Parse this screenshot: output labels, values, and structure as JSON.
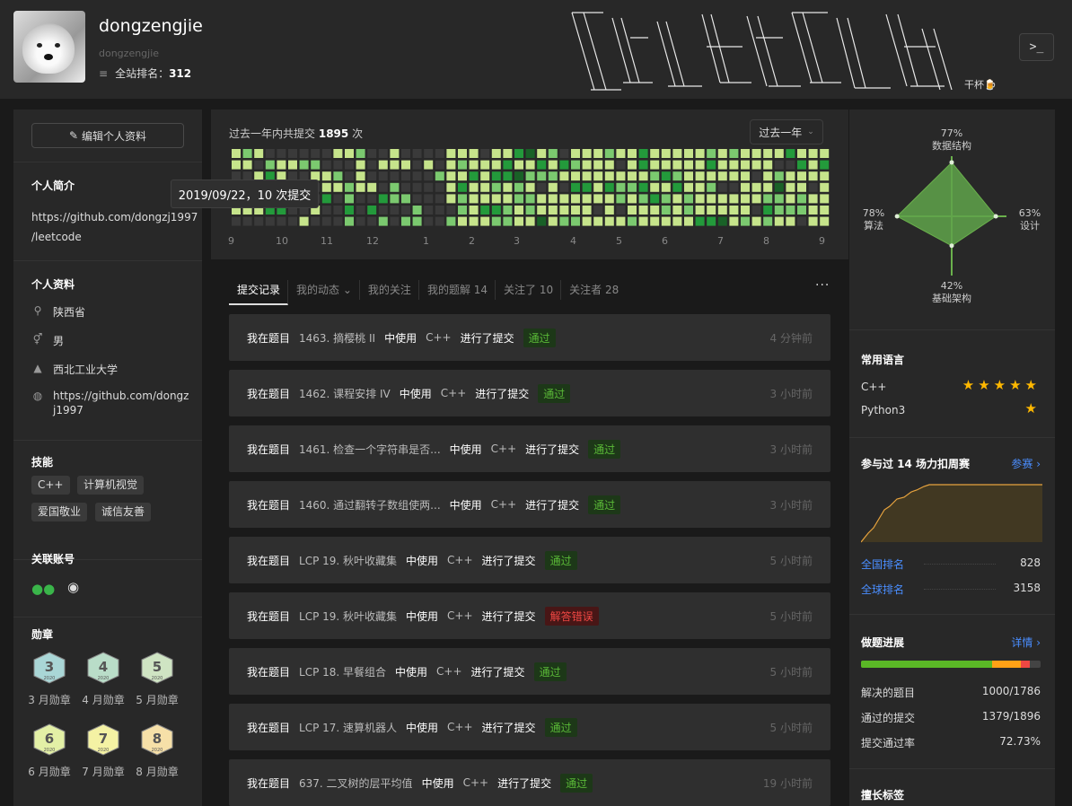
{
  "profile": {
    "name": "dongzengjie",
    "username": "dongzengjie",
    "rank_label": "全站排名：",
    "rank_value": "312",
    "cheers": "干杯🍺",
    "terminal": ">_"
  },
  "edit_button": "编辑个人资料",
  "bio": {
    "title": "个人简介",
    "lines": [
      "https://github.com/dongzj1997",
      "/leetcode"
    ]
  },
  "personal": {
    "title": "个人资料",
    "location": "陕西省",
    "gender": "男",
    "school": "西北工业大学",
    "website_lines": [
      "https://github.com/dongz",
      "j1997"
    ]
  },
  "skills": {
    "title": "技能",
    "tags": [
      "C++",
      "计算机视觉",
      "爱国敬业",
      "诚信友善"
    ]
  },
  "accounts": {
    "title": "关联账号"
  },
  "badges": {
    "title": "勋章",
    "items": [
      {
        "num": "3",
        "year": "2020",
        "label": "3 月勋章",
        "color": "#a9d6d6"
      },
      {
        "num": "4",
        "year": "2020",
        "label": "4 月勋章",
        "color": "#b9ddc8"
      },
      {
        "num": "5",
        "year": "2020",
        "label": "5 月勋章",
        "color": "#cfe4c3"
      },
      {
        "num": "6",
        "year": "2020",
        "label": "6 月勋章",
        "color": "#e3f0a6"
      },
      {
        "num": "7",
        "year": "2020",
        "label": "7 月勋章",
        "color": "#f4f2a4"
      },
      {
        "num": "8",
        "year": "2020",
        "label": "8 月勋章",
        "color": "#f6e0a8"
      }
    ]
  },
  "calendar": {
    "title_prefix": "过去一年内共提交",
    "count": "1895",
    "title_suffix": "次",
    "year_select": "过去一年",
    "months": [
      "9",
      "10",
      "11",
      "12",
      "1",
      "2",
      "3",
      "4",
      "5",
      "6",
      "7",
      "8",
      "9"
    ],
    "tooltip": "2019/09/22，10 次提交",
    "colors": {
      "none": "#3a3a3a",
      "l1": "#c6e48b",
      "l2": "#7bc96f",
      "l3": "#239a3b",
      "l4": "#196127"
    }
  },
  "tabs": [
    "提交记录",
    "我的动态",
    "我的关注",
    "我的题解 14",
    "关注了 10",
    "关注者 28"
  ],
  "submissions": [
    {
      "a": "我在题目",
      "problem": "1463. 摘樱桃 II",
      "use": "中使用",
      "lang": "C++",
      "submit": "进行了提交",
      "status": "通过",
      "ok": true,
      "time": "4 分钟前"
    },
    {
      "a": "我在题目",
      "problem": "1462. 课程安排 IV",
      "use": "中使用",
      "lang": "C++",
      "submit": "进行了提交",
      "status": "通过",
      "ok": true,
      "time": "3 小时前"
    },
    {
      "a": "我在题目",
      "problem": "1461. 检查一个字符串是否...",
      "use": "中使用",
      "lang": "C++",
      "submit": "进行了提交",
      "status": "通过",
      "ok": true,
      "time": "3 小时前"
    },
    {
      "a": "我在题目",
      "problem": "1460. 通过翻转子数组使两...",
      "use": "中使用",
      "lang": "C++",
      "submit": "进行了提交",
      "status": "通过",
      "ok": true,
      "time": "3 小时前"
    },
    {
      "a": "我在题目",
      "problem": "LCP 19. 秋叶收藏集",
      "use": "中使用",
      "lang": "C++",
      "submit": "进行了提交",
      "status": "通过",
      "ok": true,
      "time": "5 小时前"
    },
    {
      "a": "我在题目",
      "problem": "LCP 19. 秋叶收藏集",
      "use": "中使用",
      "lang": "C++",
      "submit": "进行了提交",
      "status": "解答错误",
      "ok": false,
      "time": "5 小时前"
    },
    {
      "a": "我在题目",
      "problem": "LCP 18. 早餐组合",
      "use": "中使用",
      "lang": "C++",
      "submit": "进行了提交",
      "status": "通过",
      "ok": true,
      "time": "5 小时前"
    },
    {
      "a": "我在题目",
      "problem": "LCP 17. 速算机器人",
      "use": "中使用",
      "lang": "C++",
      "submit": "进行了提交",
      "status": "通过",
      "ok": true,
      "time": "5 小时前"
    },
    {
      "a": "我在题目",
      "problem": "637. 二叉树的层平均值",
      "use": "中使用",
      "lang": "C++",
      "submit": "进行了提交",
      "status": "通过",
      "ok": true,
      "time": "19 小时前"
    }
  ],
  "radar": {
    "top": {
      "pct": "77%",
      "name": "数据结构",
      "value": 0.77
    },
    "right": {
      "pct": "63%",
      "name": "设计",
      "value": 0.63
    },
    "bottom": {
      "pct": "42%",
      "name": "基础架构",
      "value": 0.42
    },
    "left": {
      "pct": "78%",
      "name": "算法",
      "value": 0.78
    }
  },
  "languages": {
    "title": "常用语言",
    "items": [
      {
        "name": "C++",
        "stars": "★★★★★"
      },
      {
        "name": "Python3",
        "stars": "★"
      }
    ]
  },
  "contest": {
    "title": "参与过 14 场力扣周赛",
    "link": "参赛 ›",
    "national_label": "全国排名",
    "national_value": "828",
    "global_label": "全球排名",
    "global_value": "3158"
  },
  "progress": {
    "title": "做题进展",
    "link": "详情 ›",
    "solved_label": "解决的题目",
    "solved_value": "1000/1786",
    "passed_label": "通过的提交",
    "passed_value": "1379/1896",
    "rate_label": "提交通过率",
    "rate_value": "72.73%",
    "easy": 0.73,
    "medium": 0.16,
    "hard": 0.05
  },
  "skill_tags_title": "擅长标签"
}
